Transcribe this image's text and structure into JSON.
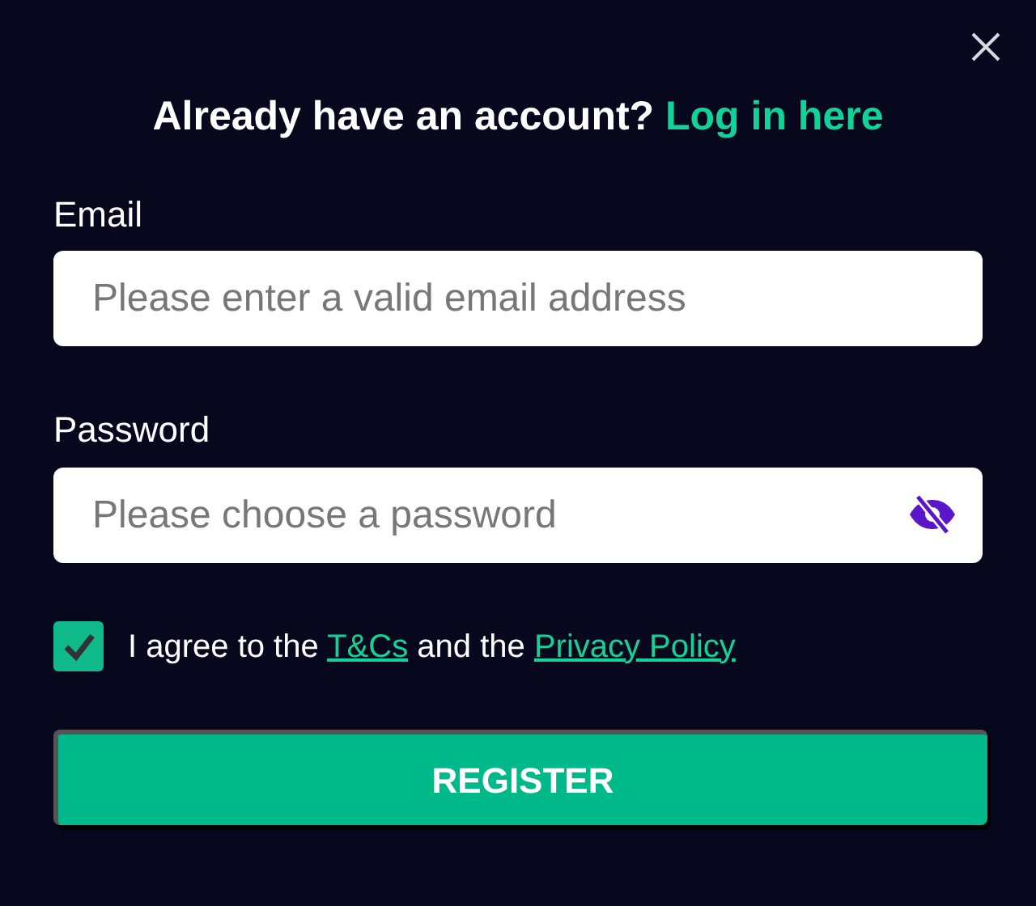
{
  "heading": {
    "text": "Already have an account?",
    "link": "Log in here"
  },
  "email": {
    "label": "Email",
    "placeholder": "Please enter a valid email address"
  },
  "password": {
    "label": "Password",
    "placeholder": "Please choose a password"
  },
  "agreement": {
    "checked": true,
    "before": "I agree to the",
    "terms_link": "T&Cs",
    "middle": "and the",
    "privacy_link": "Privacy Policy"
  },
  "submit": {
    "label": "REGISTER"
  }
}
